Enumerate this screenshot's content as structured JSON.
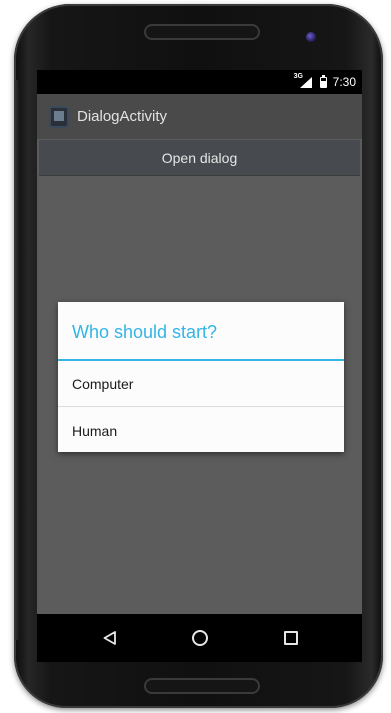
{
  "status_bar": {
    "network": "3G",
    "time": "7:30"
  },
  "app": {
    "title": "DialogActivity",
    "open_dialog_label": "Open dialog"
  },
  "dialog": {
    "title": "Who should start?",
    "options": [
      {
        "label": "Computer"
      },
      {
        "label": "Human"
      }
    ]
  },
  "navigation": {
    "back": "back-icon",
    "home": "home-icon",
    "recents": "recents-icon"
  },
  "colors": {
    "accent": "#33b5e5",
    "dim_background": "#5c5c5c"
  }
}
